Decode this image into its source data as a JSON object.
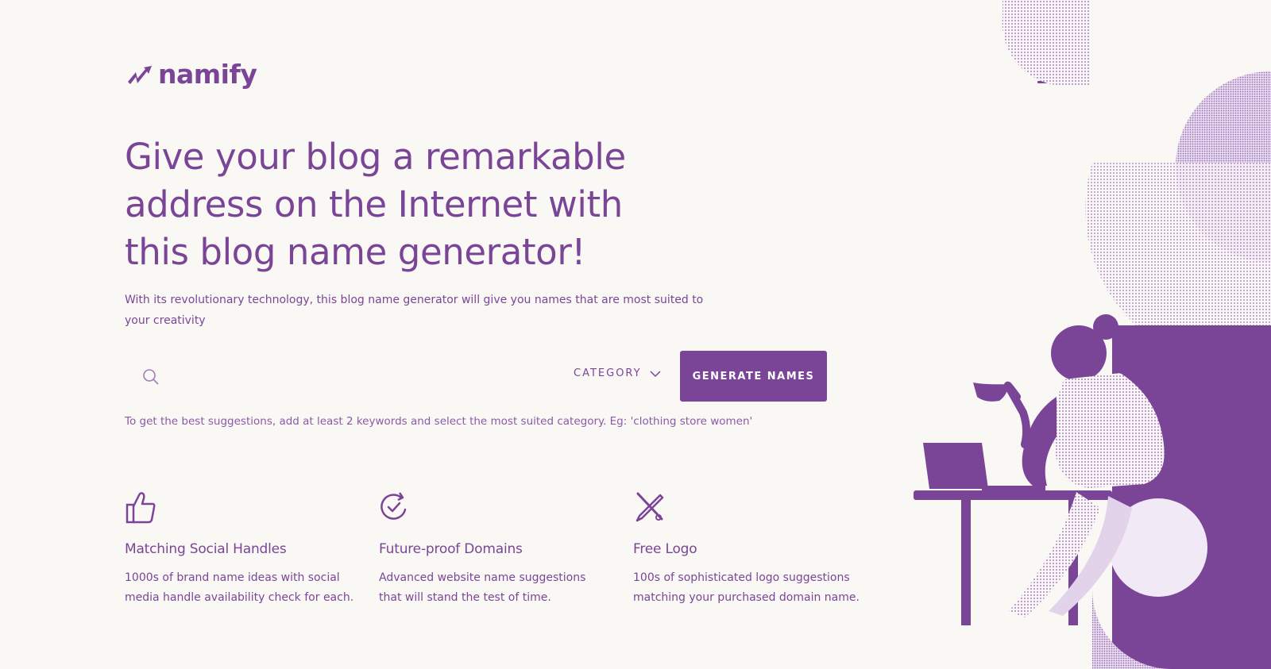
{
  "brand": {
    "name": "namify"
  },
  "hero": {
    "headline": "Give your blog a remarkable address on the Internet with this blog name generator!",
    "subtext": "With its revolutionary technology, this blog name generator will give you names that are most suited to your creativity"
  },
  "search": {
    "value": "",
    "placeholder": "",
    "category_label": "CATEGORY",
    "button_label": "GENERATE NAMES",
    "hint": "To get the best suggestions, add at least 2 keywords and select the most suited category. Eg: 'clothing store women'"
  },
  "features": [
    {
      "icon": "thumbs-up-icon",
      "title": "Matching Social Handles",
      "text": "1000s of brand name ideas with social media handle availability check for each."
    },
    {
      "icon": "refresh-check-icon",
      "title": "Future-proof Domains",
      "text": "Advanced website name suggestions that will stand the test of time."
    },
    {
      "icon": "pencil-ruler-icon",
      "title": "Free Logo",
      "text": "100s of sophisticated logo suggestions matching your purchased domain name."
    }
  ],
  "colors": {
    "brand": "#7b4597",
    "background": "#faf8f5",
    "light_purple": "#d9c6e6"
  }
}
